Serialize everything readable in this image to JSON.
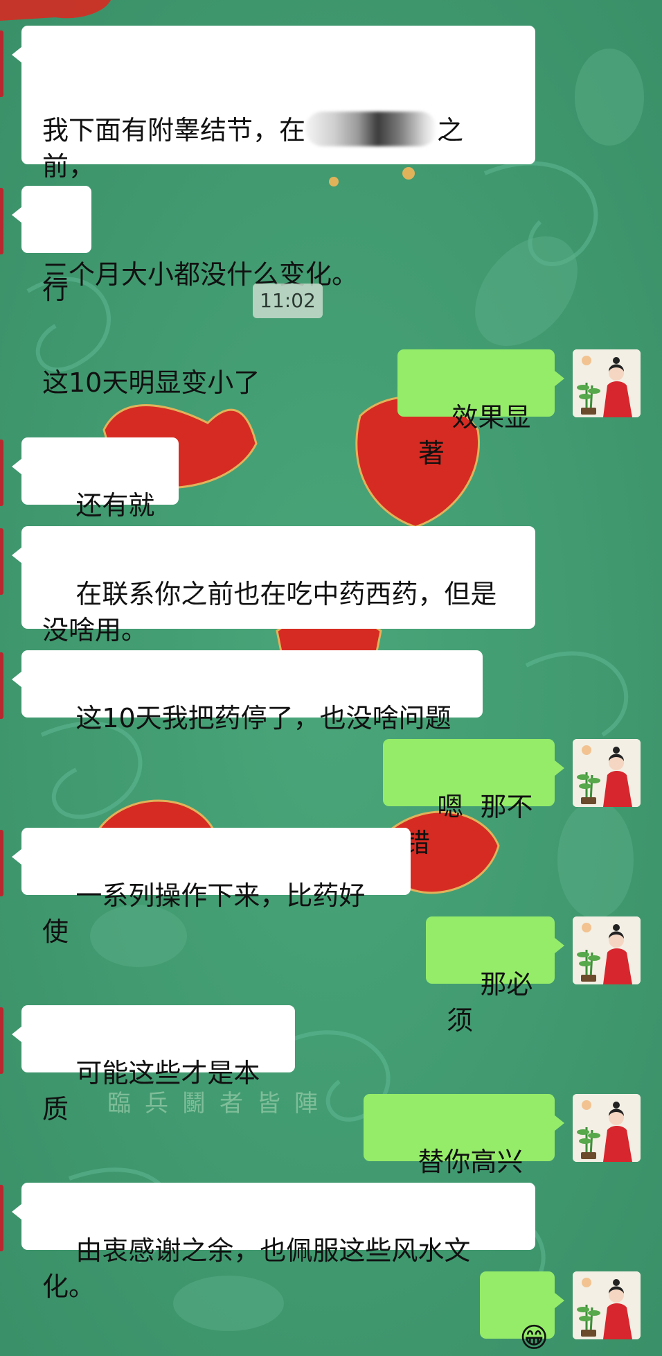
{
  "chat": {
    "timestamp": "11:02",
    "messages": [
      {
        "side": "in",
        "lines": [
          "我下面有附睾结节，在",
          "之前，",
          "三个月大小都没什么变化。",
          "这10天明显变小了"
        ]
      },
      {
        "side": "in",
        "text": "行"
      },
      {
        "side": "out",
        "text": "效果显著"
      },
      {
        "side": "in",
        "text": "还有就是"
      },
      {
        "side": "in",
        "text": "在联系你之前也在吃中药西药，但是\n没啥用。"
      },
      {
        "side": "in",
        "text": "这10天我把药停了，也没啥问题"
      },
      {
        "side": "out",
        "text": "嗯  那不错"
      },
      {
        "side": "in",
        "text": "一系列操作下来，比药好使"
      },
      {
        "side": "out",
        "text": "那必须"
      },
      {
        "side": "in",
        "text": "可能这些才是本质"
      },
      {
        "side": "out",
        "text": "替你高兴",
        "emoji": "👍"
      },
      {
        "side": "in",
        "text": "由衷感谢之余，也佩服这些风水文化。"
      },
      {
        "side": "out",
        "emoji": "😁"
      }
    ]
  },
  "background": {
    "calligraphy": "臨兵鬭者皆陣",
    "colors": {
      "bg": "#3f9a6f",
      "accent": "#d62b22",
      "gold": "#e0b35a"
    }
  },
  "theme": {
    "incoming_bubble": "#ffffff",
    "outgoing_bubble": "#95ec69"
  }
}
